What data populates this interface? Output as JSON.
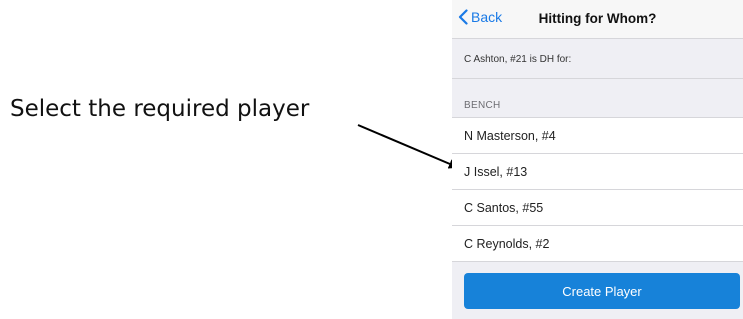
{
  "annotation": {
    "text": "Select the required player"
  },
  "navbar": {
    "back_label": "Back",
    "title": "Hitting for Whom?",
    "back_icon": "chevron-left-icon",
    "accent_color": "#1a7ae6"
  },
  "context": {
    "text": "C Ashton, #21 is DH for:"
  },
  "bench": {
    "header": "BENCH",
    "players": [
      {
        "name": "N Masterson, #4"
      },
      {
        "name": "J Issel, #13"
      },
      {
        "name": "C Santos, #55"
      },
      {
        "name": "C Reynolds, #2"
      }
    ]
  },
  "create_button": {
    "label": "Create Player",
    "color": "#1782d9"
  }
}
